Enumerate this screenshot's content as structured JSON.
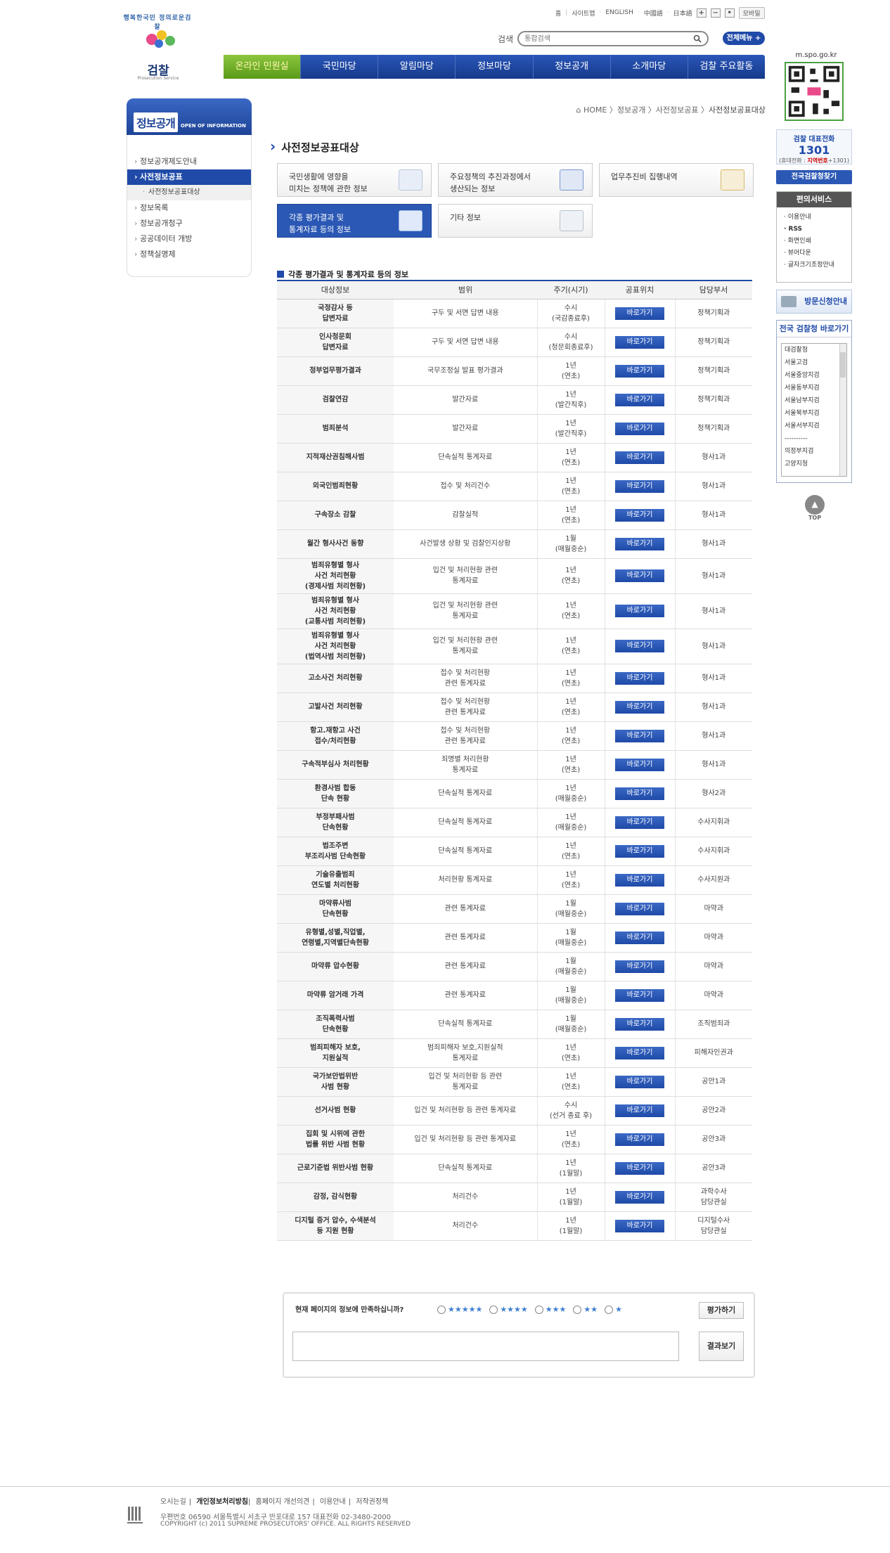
{
  "logo": {
    "ring": "행복한국민 정의로운검찰",
    "name": "검찰",
    "sub": "Prosecution Service"
  },
  "util": {
    "home": "홈",
    "sitemap": "사이트맵",
    "english": "ENGLISH",
    "chinese": "中國語",
    "japanese": "日本語",
    "plus": "+",
    "minus": "−",
    "reset": "•",
    "mobile": "모바일"
  },
  "search": {
    "label": "검색",
    "placeholder": "통합검색",
    "allmenu": "전체메뉴 +"
  },
  "gnb": [
    "온라인 민원실",
    "국민마당",
    "알림마당",
    "정보마당",
    "정보공개",
    "소개마당",
    "검찰 주요활동"
  ],
  "right": {
    "mspo": "m.spo.go.kr",
    "call_title": "검찰 대표전화",
    "call_num": "1301",
    "call_sub1": "(휴대전화 : ",
    "call_sub2": "지역번호",
    "call_sub3": "+1301)",
    "findall": "전국검찰청찾기",
    "conv_title": "편의서비스",
    "conv_items": [
      "· 이용안내",
      "· RSS",
      "· 화면인쇄",
      "· 뷰어다운",
      "· 글자크기조정안내"
    ],
    "visit": "방문신청안내",
    "nat_title": "전국 검찰청 바로가기",
    "nat_items": [
      "대검찰청",
      "서울고검",
      "서울중앙지검",
      "서울동부지검",
      "서울남부지검",
      "서울북부지검",
      "서울서부지검",
      "----------",
      "의정부지검",
      "고양지청"
    ],
    "top": "TOP"
  },
  "lnb": {
    "title": "정보공개",
    "title_en": "OPEN OF INFORMATION",
    "items": [
      "정보공개제도안내",
      "사전정보공표",
      "사전정보공표대상",
      "정보목록",
      "정보공개청구",
      "공공데이터 개방",
      "정책실명제"
    ]
  },
  "bread": {
    "path": "⌂ HOME 〉정보공개 〉사전정보공표 〉",
    "current": "사전정보공표대상"
  },
  "page_title": "사전정보공표대상",
  "cats": [
    [
      "국민생활에 영향을",
      "미치는 정책에 관한 정보"
    ],
    [
      "주요정책의 추진과정에서",
      "생산되는 정보"
    ],
    [
      "업무추진비 집행내역",
      ""
    ],
    [
      "각종 평가결과 및",
      "통계자료 등의 정보"
    ],
    [
      "기타 정보",
      ""
    ]
  ],
  "section_title": "각종 평가결과 및 통계자료 등의 정보",
  "table": {
    "headers": [
      "대상정보",
      "범위",
      "주기(시기)",
      "공표위치",
      "담당부서"
    ],
    "go_label": "바로가기",
    "rows": [
      [
        "국정감사 등\n답변자료",
        "구두 및 서면 답변 내용",
        "수시\n(국감종료후)",
        "정책기획과"
      ],
      [
        "인사청문회\n답변자료",
        "구두 및 서면 답변 내용",
        "수시\n(청문회종료후)",
        "정책기획과"
      ],
      [
        "정부업무평가결과",
        "국무조정실 발표 평가결과",
        "1년\n(연초)",
        "정책기획과"
      ],
      [
        "검찰연감",
        "발간자료",
        "1년\n(발간직후)",
        "정책기획과"
      ],
      [
        "범죄분석",
        "발간자료",
        "1년\n(발간직후)",
        "정책기획과"
      ],
      [
        "지적재산권침해사범",
        "단속실적 통계자료",
        "1년\n(연초)",
        "형사1과"
      ],
      [
        "외국인범죄현황",
        "접수 및 처리건수",
        "1년\n(연초)",
        "형사1과"
      ],
      [
        "구속장소 감찰",
        "감찰실적",
        "1년\n(연초)",
        "형사1과"
      ],
      [
        "월간 형사사건 동향",
        "사건발생 상황 및 검찰인지상황",
        "1월\n(매월중순)",
        "형사1과"
      ],
      [
        "범죄유형별 형사\n사건 처리현황\n(경제사범 처리현황)",
        "입건 및 처리현황 관련\n통계자료",
        "1년\n(연초)",
        "형사1과"
      ],
      [
        "범죄유형별 형사\n사건 처리현황\n(교통사범 처리현황)",
        "입건 및 처리현황 관련\n통계자료",
        "1년\n(연초)",
        "형사1과"
      ],
      [
        "범죄유형별 형사\n사건 처리현황\n(법역사범 처리현황)",
        "입건 및 처리현황 관련\n통계자료",
        "1년\n(연초)",
        "형사1과"
      ],
      [
        "고소사건 처리현황",
        "접수 및 처리현황\n관련 통계자료",
        "1년\n(연초)",
        "형사1과"
      ],
      [
        "고발사건 처리현황",
        "접수 및 처리현황\n관련 통계자료",
        "1년\n(연초)",
        "형사1과"
      ],
      [
        "항고.재항고 사건\n접수/처리현황",
        "접수 및 처리현황\n관련 통계자료",
        "1년\n(연초)",
        "형사1과"
      ],
      [
        "구속적부심사 처리현황",
        "죄명별 처리현황\n통계자료",
        "1년\n(연초)",
        "형사1과"
      ],
      [
        "환경사범 합동\n단속 현황",
        "단속실적 통계자료",
        "1년\n(매월중순)",
        "형사2과"
      ],
      [
        "부정부패사범\n단속현황",
        "단속실적 통계자료",
        "1년\n(매월중순)",
        "수사지휘과"
      ],
      [
        "법조주변\n부조리사범 단속현황",
        "단속실적 통계자료",
        "1년\n(연초)",
        "수사지휘과"
      ],
      [
        "기술유출범죄\n연도별 처리현황",
        "처리현황 통계자료",
        "1년\n(연초)",
        "수사지원과"
      ],
      [
        "마약류사범\n단속현황",
        "관련 통계자료",
        "1월\n(매월중순)",
        "마약과"
      ],
      [
        "유형별,성별,직업별,\n연령별,지역별단속현황",
        "관련 통계자료",
        "1월\n(매월중순)",
        "마약과"
      ],
      [
        "마약류 압수현황",
        "관련 통계자료",
        "1월\n(매월중순)",
        "마약과"
      ],
      [
        "마약류 암거래 가격",
        "관련 통계자료",
        "1월\n(매월중순)",
        "마약과"
      ],
      [
        "조직폭력사범\n단속현황",
        "단속실적 통계자료",
        "1월\n(매월중순)",
        "조직범죄과"
      ],
      [
        "범죄피해자 보호,\n지원실적",
        "범죄피해자 보호,지원실적\n통계자료",
        "1년\n(연초)",
        "피해자인권과"
      ],
      [
        "국가보안법위반\n사범 현황",
        "입건 및 처리현황 등 관련\n통계자료",
        "1년\n(연초)",
        "공안1과"
      ],
      [
        "선거사범 현황",
        "입건 및 처리현황 등 관련 통계자료",
        "수시\n(선거 종료 후)",
        "공안2과"
      ],
      [
        "집회 및 시위에 관한\n법률 위반 사범 현황",
        "입건 및 처리현황 등 관련 통계자료",
        "1년\n(연초)",
        "공안3과"
      ],
      [
        "근로기준법 위반사범 현황",
        "단속실적 통계자료",
        "1년\n(1월말)",
        "공안3과"
      ],
      [
        "감정, 감식현황",
        "처리건수",
        "1년\n(1월말)",
        "과학수사\n담당관실"
      ],
      [
        "디지털 증거 압수, 수색분석\n등 지원 현황",
        "처리건수",
        "1년\n(1월말)",
        "디지털수사\n담당관실"
      ]
    ]
  },
  "survey": {
    "question": "현재 페이지의 정보에 만족하십니까?",
    "options": [
      "★★★★★",
      "★★★★",
      "★★★",
      "★★",
      "★"
    ],
    "eval_button": "평가하기",
    "result_button": "결과보기"
  },
  "footer": {
    "links": [
      "오시는길",
      "|",
      "개인정보처리방침",
      "|",
      "홈페이지 개선의견",
      "|",
      "이용안내",
      "|",
      "저작권정책"
    ],
    "address": "우편번호 06590 서울특별시 서초구 반포대로 157  대표전화 02-3480-2000",
    "copyright": "COPYRIGHT (c) 2011 SUPREME PROSECUTORS' OFFICE. ALL RIGHTS RESERVED"
  },
  "colors": {
    "primary": "#1f4aa8",
    "gnb_active": "#7ab530"
  }
}
